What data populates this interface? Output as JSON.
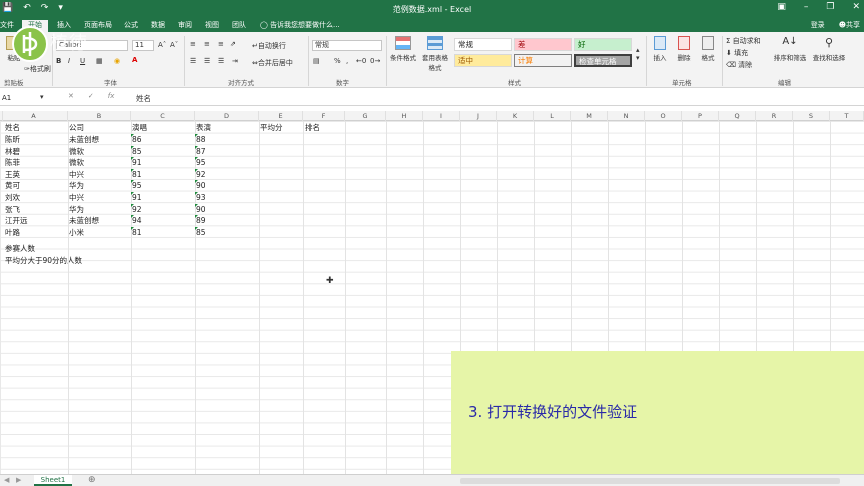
{
  "window": {
    "title": "范例数据.xml - Excel",
    "login": "登录",
    "share": "共享"
  },
  "tabs": [
    "文件",
    "开始",
    "插入",
    "页面布局",
    "公式",
    "数据",
    "审阅",
    "视图",
    "团队"
  ],
  "active_tab": "开始",
  "tell_me": "告诉我您想要做什么...",
  "ribbon": {
    "clipboard": "剪贴板",
    "paste": "粘贴",
    "format_painter": "格式刷",
    "font_group": "字体",
    "font_name": "Calibri",
    "font_size": "11",
    "bold": "B",
    "italic": "I",
    "underline": "U",
    "align_group": "对齐方式",
    "wrap_text": "自动换行",
    "merge_center": "合并后居中",
    "number_group": "数字",
    "number_format": "常规",
    "styles_group": "样式",
    "conditional_format": "条件格式",
    "format_as_table": "套用表格格式",
    "style_normal": "常规",
    "style_bad": "差",
    "style_good": "好",
    "style_neutral": "适中",
    "style_calc": "计算",
    "style_check": "检查单元格",
    "cells_group": "单元格",
    "insert": "插入",
    "delete": "删除",
    "format": "格式",
    "editing_group": "编辑",
    "autosum": "自动求和",
    "fill": "填充",
    "clear": "清除",
    "sort_filter": "排序和筛选",
    "find_select": "查找和选择"
  },
  "logo_text": "植徳",
  "formula_bar": {
    "name_box": "A1",
    "content": "姓名"
  },
  "columns": [
    "A",
    "B",
    "C",
    "D",
    "E",
    "F",
    "G",
    "H",
    "I",
    "J",
    "K",
    "L",
    "M",
    "N",
    "O",
    "P",
    "Q",
    "R",
    "S",
    "T"
  ],
  "headers": [
    "姓名",
    "公司",
    "演唱",
    "表演",
    "平均分",
    "排名"
  ],
  "rows": [
    [
      "陈昕",
      "未蓝创想",
      "86",
      "88"
    ],
    [
      "林碧",
      "微软",
      "85",
      "87"
    ],
    [
      "陈菲",
      "微软",
      "91",
      "95"
    ],
    [
      "王英",
      "中兴",
      "81",
      "92"
    ],
    [
      "黄可",
      "华为",
      "95",
      "90"
    ],
    [
      "刘欢",
      "中兴",
      "91",
      "93"
    ],
    [
      "张飞",
      "华为",
      "92",
      "90"
    ],
    [
      "江开远",
      "未蓝创想",
      "94",
      "89"
    ],
    [
      "叶路",
      "小米",
      "81",
      "85"
    ]
  ],
  "notes": [
    "参赛人数",
    "平均分大于90分的人数"
  ],
  "caption": "3. 打开转换好的文件验证",
  "sheet_tab": "Sheet1",
  "colors": {
    "excel_green": "#217346",
    "caption_bg": "#e6f5a8",
    "caption_text": "#2a2aa8",
    "bad_bg": "#ffc7ce",
    "good_bg": "#c6efce",
    "neutral_bg": "#ffeb9c",
    "calc_bg": "#f2f2f2",
    "check_bg": "#a5a5a5"
  }
}
